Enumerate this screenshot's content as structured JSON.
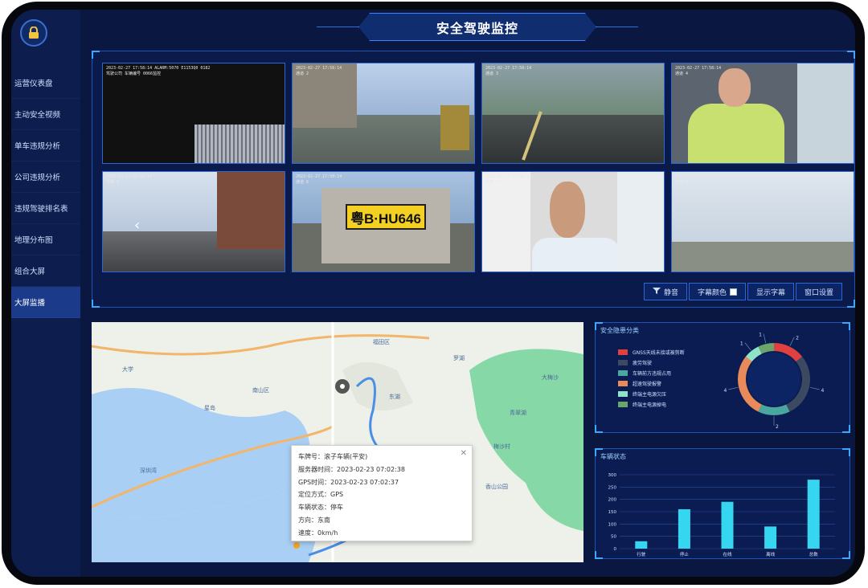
{
  "header": {
    "title": "安全驾驶监控"
  },
  "sidebar": {
    "items": [
      {
        "label": "运营仪表盘"
      },
      {
        "label": "主动安全视频"
      },
      {
        "label": "单车违规分析"
      },
      {
        "label": "公司违规分析"
      },
      {
        "label": "违规驾驶排名表"
      },
      {
        "label": "地理分布图"
      },
      {
        "label": "组合大屏"
      },
      {
        "label": "大屏监播",
        "active": true
      }
    ]
  },
  "video": {
    "osd": [
      {
        "line1": "2023-02-27 17:58:14 ALARM:5070 E1153Q0 0182",
        "line2": "驾驶公司  车辆编号  0066监控"
      },
      {
        "line1": "2023-02-27 17:58:14",
        "line2": "通道 2"
      },
      {
        "line1": "2023-02-27 17:58:14",
        "line2": "通道 3"
      },
      {
        "line1": "2023-02-27 17:58:14",
        "line2": "通道 4"
      },
      {
        "line1": "2023-02-27 17:58:14",
        "line2": "通道 5"
      },
      {
        "line1": "2023-02-27 17:58:14",
        "line2": "通道 6"
      },
      {
        "line1": "2023-02-27 17:58:14",
        "line2": "通道 7"
      },
      {
        "line1": "2023-02-27 17:58:14",
        "line2": "通道 8"
      }
    ],
    "plate": "粤B·HU646",
    "buttons": {
      "mute": "静音",
      "subtitle_color": "字幕颜色",
      "show_subtitle": "显示字幕",
      "window_settings": "窗口设置"
    }
  },
  "map": {
    "labels": [
      "大学",
      "星岛",
      "东湖",
      "青翠湖",
      "香山公园",
      "福田区",
      "南山区",
      "深圳湾",
      "蛇口",
      "罗湖",
      "大梅沙",
      "梅沙村"
    ],
    "popup": {
      "plate": "车牌号：",
      "plate_value": "滚子车辆(平安)",
      "server_time": "服务器时间：",
      "server_time_value": "2023-02-23 07:02:38",
      "gps_time": "GPS时间：",
      "gps_time_value": "2023-02-23 07:02:37",
      "location_mode": "定位方式：",
      "location_mode_value": "GPS",
      "vehicle_state": "车辆状态：",
      "vehicle_state_value": "停车",
      "direction": "方向：",
      "direction_value": "东南",
      "speed": "速度：",
      "speed_value": "0km/h",
      "close": "✕"
    }
  },
  "safety_panel": {
    "title": "安全隐患分类",
    "items": [
      {
        "label": "GNSS天线未接或被剪断",
        "color": "#e04040"
      },
      {
        "label": "疲劳驾驶",
        "color": "#3b4a60"
      },
      {
        "label": "车辆前方违规占用",
        "color": "#4aa7a0"
      },
      {
        "label": "超速驾驶报警",
        "color": "#e88a5a"
      },
      {
        "label": "终端主电源欠压",
        "color": "#8fe3c8"
      },
      {
        "label": "终端主电源掉电",
        "color": "#6aa56a"
      }
    ],
    "donut": [
      {
        "value": 2,
        "label": "2",
        "color": "#e04040"
      },
      {
        "value": 4,
        "label": "4",
        "color": "#3b4a60"
      },
      {
        "value": 2,
        "label": "2",
        "color": "#4aa7a0"
      },
      {
        "value": 4,
        "label": "4",
        "color": "#e88a5a"
      },
      {
        "value": 1,
        "label": "1",
        "color": "#8fe3c8"
      },
      {
        "value": 1,
        "label": "1",
        "color": "#6aa56a"
      }
    ]
  },
  "vehicle_panel": {
    "title": "车辆状态"
  },
  "chart_data": {
    "type": "bar",
    "title": "车辆状态",
    "categories": [
      "行驶",
      "停止",
      "在线",
      "离线",
      "总数"
    ],
    "values": [
      30,
      160,
      190,
      90,
      280
    ],
    "ylim": [
      0,
      300
    ],
    "yticks": [
      0,
      50,
      100,
      150,
      200,
      250,
      300
    ],
    "grid": true,
    "bar_color": "#36d6f0"
  }
}
